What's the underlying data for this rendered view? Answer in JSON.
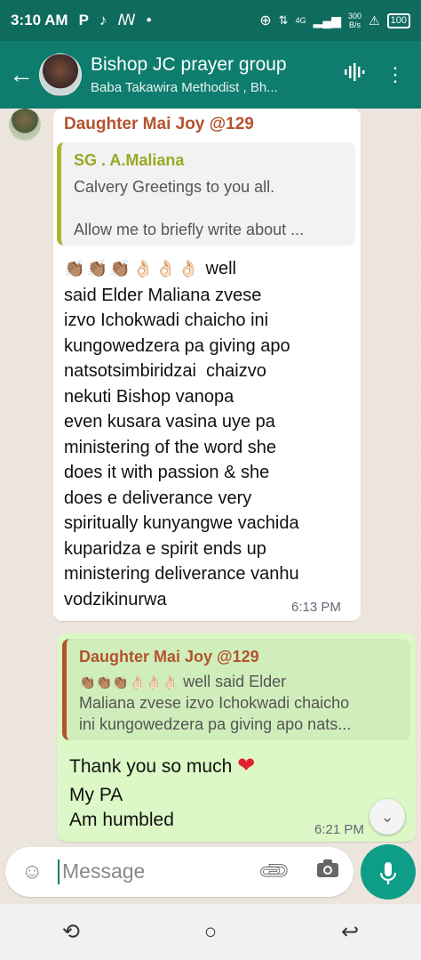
{
  "status_bar": {
    "time": "3:10 AM",
    "p_icon": "P",
    "network": "4G",
    "speed_value": "300",
    "speed_unit": "B/s",
    "battery": "100"
  },
  "header": {
    "title": "Bishop JC prayer group",
    "subtitle": "Baba Takawira Methodist , Bh..."
  },
  "messages": {
    "incoming": {
      "sender": "Daughter Mai Joy @129",
      "quote": {
        "name": "SG . A.Maliana",
        "line1": "Calvery Greetings to you all.",
        "line2": "Allow me to briefly write about ..."
      },
      "emojis": "👏🏽👏🏽👏🏽👌🏻👌🏻👌🏻",
      "first_word": "well",
      "lines": [
        "said Elder Maliana zvese",
        "izvo Ichokwadi chaicho ini",
        "kungowedzera pa giving apo",
        "natsotsimbiridzai  chaizvo",
        "nekuti Bishop vanopa",
        "even kusara vasina uye pa",
        "ministering of the word she",
        "does it with passion & she",
        "does e deliverance very",
        "spiritually kunyangwe vachida",
        "kuparidza e spirit ends up",
        "ministering deliverance vanhu",
        "vodzikinurwa"
      ],
      "time": "6:13 PM"
    },
    "outgoing": {
      "quote": {
        "name": "Daughter Mai Joy @129",
        "emojis": "👏🏽👏🏽👏🏽👌🏻👌🏻👌🏻",
        "line1": "well said Elder",
        "line2": "Maliana zvese izvo Ichokwadi chaicho",
        "line3": "ini kungowedzera pa giving apo nats..."
      },
      "line1": "Thank you so much",
      "heart": "❤",
      "line2": "My PA",
      "line3": "Am humbled",
      "time": "6:21 PM"
    }
  },
  "input": {
    "placeholder": "Message"
  },
  "icons": {
    "back": "arrow-left-icon",
    "audio": "audio-wave-icon",
    "menu": "more-vert-icon",
    "scroll": "chevron-double-down-icon",
    "emoji": "emoji-icon",
    "attach": "paperclip-icon",
    "camera": "camera-icon",
    "mic": "mic-icon"
  },
  "colors": {
    "header": "#0e7d6e",
    "statusbar": "#0e6b5e",
    "incoming_bubble": "#ffffff",
    "outgoing_bubble": "#dcf8c6",
    "sender_name": "#b5532f",
    "quote_name": "#9aa823",
    "mic_button": "#0e9e87"
  }
}
